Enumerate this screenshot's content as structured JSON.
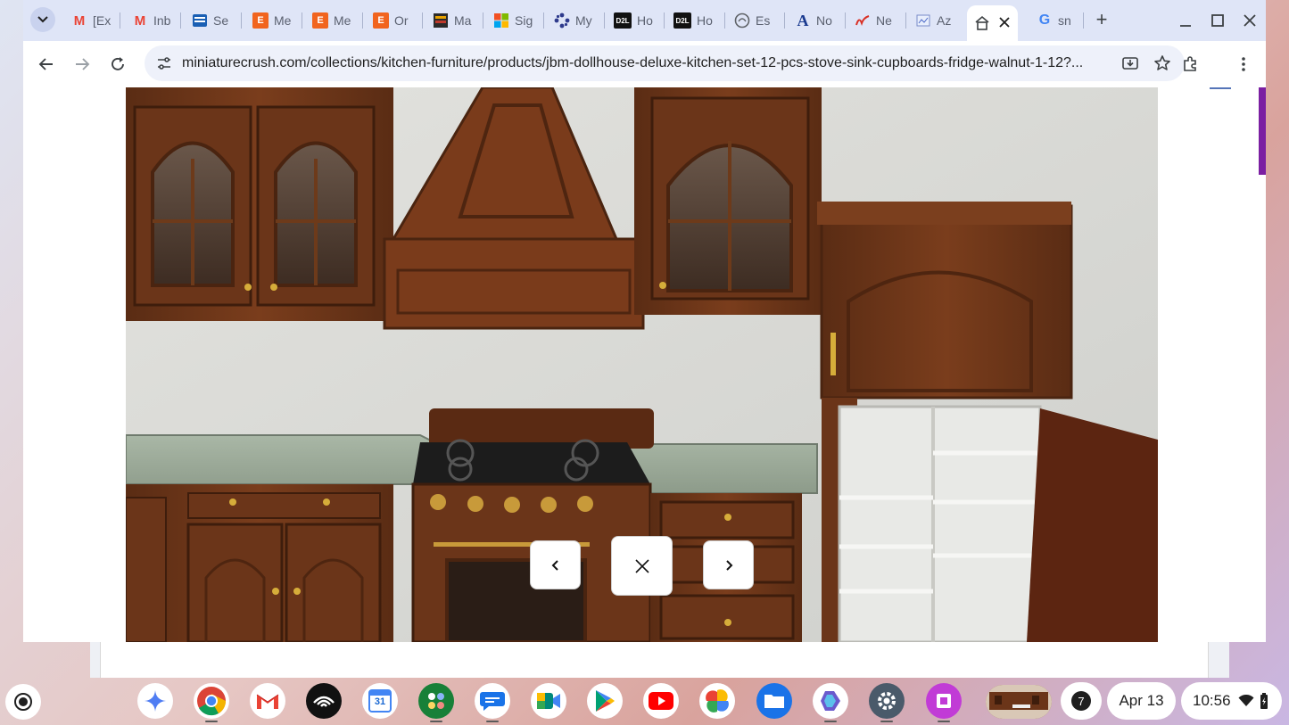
{
  "tabs": [
    {
      "label": "[Ex",
      "icon": "gmail-icon"
    },
    {
      "label": "Inb",
      "icon": "gmail-icon"
    },
    {
      "label": "Se",
      "icon": "site-icon"
    },
    {
      "label": "Me",
      "icon": "etsy-icon"
    },
    {
      "label": "Me",
      "icon": "etsy-icon"
    },
    {
      "label": "Or",
      "icon": "etsy-icon"
    },
    {
      "label": "Ma",
      "icon": "site-icon"
    },
    {
      "label": "Sig",
      "icon": "microsoft-icon"
    },
    {
      "label": "My",
      "icon": "pinwheel-icon"
    },
    {
      "label": "Ho",
      "icon": "d2l-icon"
    },
    {
      "label": "Ho",
      "icon": "d2l-icon"
    },
    {
      "label": "Es",
      "icon": "site-icon"
    },
    {
      "label": "No",
      "icon": "letter-a-icon"
    },
    {
      "label": "Ne",
      "icon": "signature-icon"
    },
    {
      "label": "Az",
      "icon": "site-icon"
    },
    {
      "label": "",
      "icon": "store-icon",
      "active": true
    },
    {
      "label": "sn",
      "icon": "google-icon"
    }
  ],
  "favicon_text": {
    "gmail": "M",
    "etsy": "E",
    "d2l": "D2L",
    "letter_a": "A",
    "google": "G"
  },
  "toolbar": {
    "url": "miniaturecrush.com/collections/kitchen-furniture/products/jbm-dollhouse-deluxe-kitchen-set-12-pcs-stove-sink-cupboards-fridge-walnut-1-12?..."
  },
  "lightbox": {
    "prev": "previous-button",
    "close": "close-button",
    "next": "next-button"
  },
  "shelf": {
    "apps": [
      "gemini",
      "chrome",
      "gmail",
      "audible",
      "calendar",
      "google-apps",
      "messages",
      "meet",
      "play-store",
      "youtube",
      "photos",
      "files",
      "copilot",
      "settings",
      "screencast"
    ],
    "calendar_day": "31",
    "notification_count": "7",
    "date": "Apr 13",
    "time": "10:56"
  },
  "colors": {
    "tabstrip": "#dfe5f7",
    "omnibox": "#eef1fa",
    "accent": "#7b1fa2",
    "wood": "#6b3518"
  }
}
